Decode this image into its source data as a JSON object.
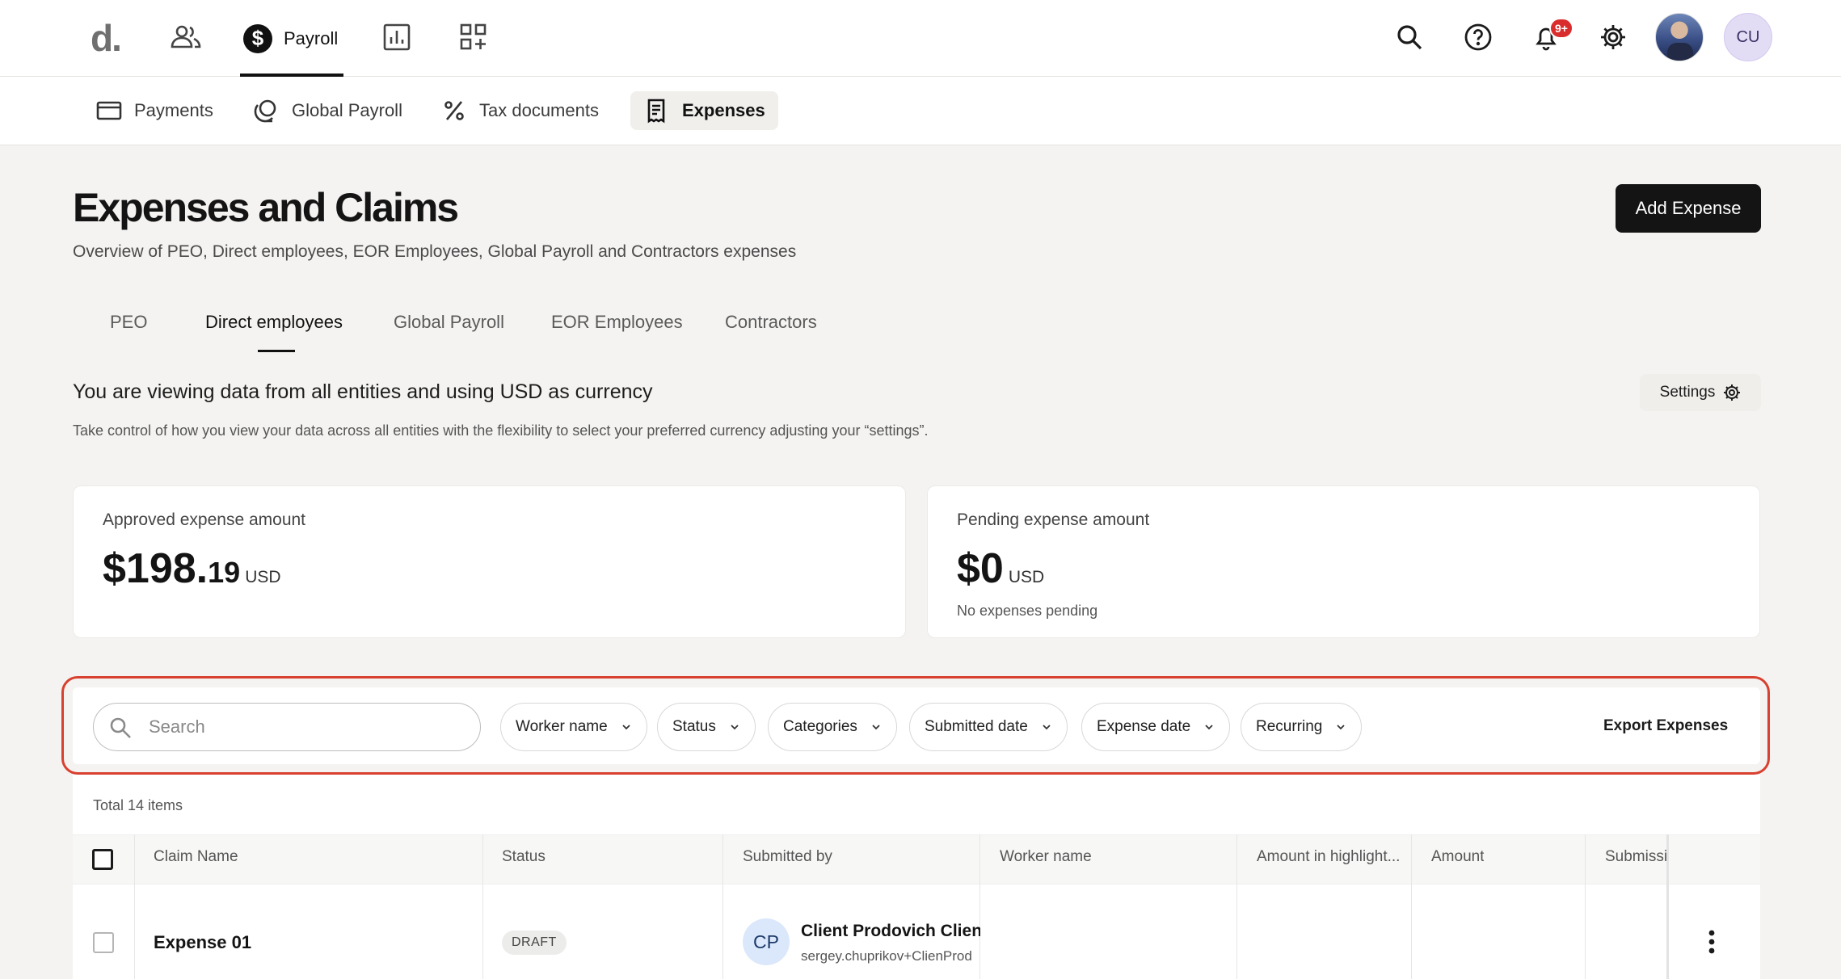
{
  "topbar": {
    "logo": "d.",
    "payroll_label": "Payroll",
    "notification_count": "9+",
    "user_initials": "CU"
  },
  "subnav": {
    "items": [
      {
        "label": "Payments",
        "icon": "card-icon"
      },
      {
        "label": "Global Payroll",
        "icon": "globe-icon"
      },
      {
        "label": "Tax documents",
        "icon": "percent-icon"
      },
      {
        "label": "Expenses",
        "icon": "receipt-icon",
        "active": true
      }
    ]
  },
  "page": {
    "title": "Expenses and Claims",
    "subtitle": "Overview of PEO, Direct employees, EOR Employees, Global Payroll and Contractors expenses",
    "add_button": "Add Expense"
  },
  "tabs": [
    {
      "label": "PEO"
    },
    {
      "label": "Direct employees",
      "active": true
    },
    {
      "label": "Global Payroll"
    },
    {
      "label": "EOR Employees"
    },
    {
      "label": "Contractors"
    }
  ],
  "info": {
    "title": "You are viewing data from all entities and using USD as currency",
    "description": "Take control of how you view your data across all entities with the flexibility to select your preferred currency adjusting your “settings”.",
    "settings_label": "Settings"
  },
  "cards": {
    "approved": {
      "label": "Approved expense amount",
      "amount_whole": "$198.",
      "amount_cents": "19",
      "currency": "USD"
    },
    "pending": {
      "label": "Pending expense amount",
      "amount_whole": "$0",
      "currency": "USD",
      "note": "No expenses pending"
    }
  },
  "filters": {
    "search_placeholder": "Search",
    "pills": [
      "Worker name",
      "Status",
      "Categories",
      "Submitted date",
      "Expense date",
      "Recurring"
    ],
    "export_label": "Export Expenses"
  },
  "table": {
    "total": "Total 14 items",
    "columns": [
      "Claim Name",
      "Status",
      "Submitted by",
      "Worker name",
      "Amount in highlight...",
      "Amount",
      "Submissi"
    ],
    "rows": [
      {
        "claim_name": "Expense 01",
        "status": "DRAFT",
        "submitter_initials": "CP",
        "submitter_name": "Client Prodovich Client",
        "submitter_email": "sergey.chuprikov+ClienProd"
      }
    ]
  },
  "colors": {
    "accent_dark": "#141414",
    "highlight_outline": "#d8402f",
    "notification_badge": "#d92d2d",
    "avatar_bg": "#e3dcf5"
  }
}
